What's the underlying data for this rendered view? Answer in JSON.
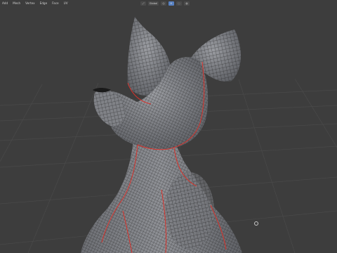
{
  "menubar": {
    "items": [
      "Add",
      "Mesh",
      "Vertex",
      "Edge",
      "Face",
      "UV"
    ]
  },
  "header": {
    "transform_orientation": "Global",
    "active_tool_highlight_color": "#5680c2"
  },
  "viewport": {
    "background_color": "#3d3d3d",
    "grid_line_color": "#4a4a4a",
    "mesh_color": "#8d8f94",
    "seam_color": "#d9322b",
    "wire_color": "#1b1b1b"
  }
}
